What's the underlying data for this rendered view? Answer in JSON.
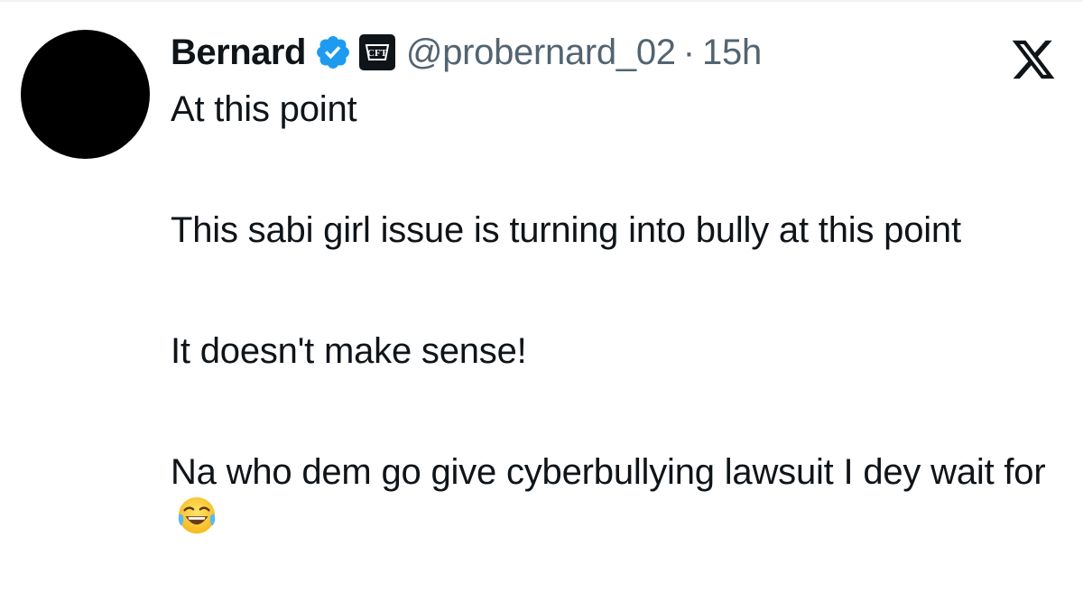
{
  "tweet": {
    "author_name": "Bernard",
    "handle": "@probernard_02",
    "separator": "·",
    "time": "15h",
    "paragraphs": [
      "At this point",
      "This sabi girl issue is turning into bully at this point",
      "It doesn't make sense!",
      "Na who dem go give cyberbullying lawsuit I dey wait for"
    ],
    "trailing_emoji": "face-with-tears-of-joy"
  },
  "icons": {
    "verified": "verified-badge-icon",
    "affiliate": "affiliate-badge-icon",
    "platform": "x-logo-icon"
  },
  "colors": {
    "verified_blue": "#1d9bf0",
    "secondary_text": "#536471",
    "primary_text": "#0f1419"
  }
}
